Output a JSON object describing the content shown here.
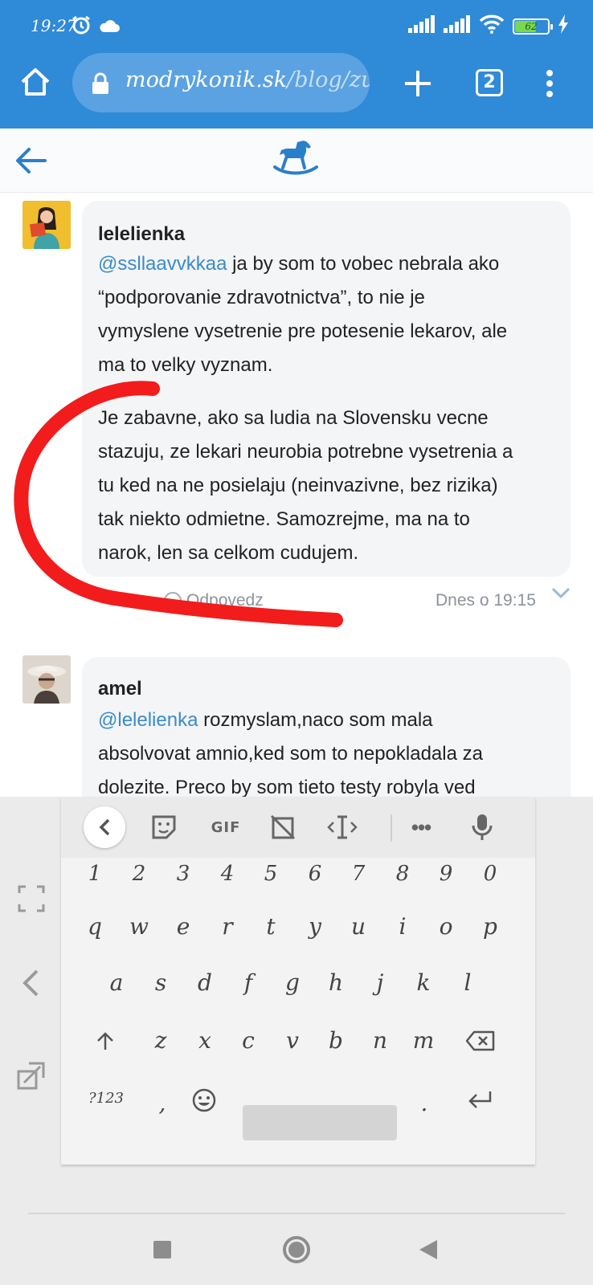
{
  "status_bar": {
    "time": "19:27",
    "battery": "62"
  },
  "browser": {
    "url_domain": "modrykonik.sk",
    "url_path": "/blog/zu:",
    "tab_count": "2"
  },
  "icons": {
    "status": [
      "alarm-icon",
      "cloud-icon",
      "signal-icon",
      "wifi-icon",
      "battery-icon",
      "charging-icon"
    ],
    "browser": [
      "home-icon",
      "lock-icon",
      "plus-icon",
      "tabs-icon",
      "more-vert-icon"
    ],
    "site": [
      "back-arrow-icon",
      "rocking-horse-logo-icon"
    ],
    "keyboard_toolbar": [
      "chevron-left-icon",
      "sticker-icon",
      "gif-icon",
      "clipboard-off-icon",
      "cursor-icon",
      "more-icon",
      "mic-icon"
    ],
    "keyboard_side": [
      "expand-icon",
      "chevron-left-icon",
      "float-icon"
    ],
    "nav": [
      "square-nav-icon",
      "circle-nav-icon",
      "triangle-nav-icon"
    ]
  },
  "colors": {
    "browser_blue": "#2f8ad8",
    "mention_blue": "#3a8bcb",
    "annotation_red": "#f21c1c"
  },
  "comments": [
    {
      "author": "lelelienka",
      "mention": "@ssllaavvkkaa",
      "text_line1_rest": " ja by som to vobec nebrala ako",
      "text_lines": [
        "“podporovanie zdravotnictva”, to nie je",
        "vymyslene vysetrenie pre potesenie lekarov, ale",
        "ma to velky vyznam."
      ],
      "para2_lines": [
        "Je zabavne, ako sa ludia na Slovensku vecne",
        "stazuju, ze lekari neurobia potrebne vysetrenia a",
        "tu ked na ne posielaju (neinvazivne, bez rizika)",
        "tak niekto odmietne. Samozrejme, ma na to",
        "narok, len sa celkom cudujem."
      ],
      "reply_label": "Odpovedz",
      "timestamp": "Dnes o 19:15"
    },
    {
      "author": "amel",
      "mention": "@lelelienka",
      "text_line1_rest": " rozmyslam,naco som mala",
      "text_lines": [
        "absolvovat amnio,ked som to nepokladala za",
        "dolezite. Preco by som tieto testy robyla ved"
      ]
    }
  ],
  "keyboard": {
    "toolbar_gif": "GIF",
    "toolbar_more": "•••",
    "numbers": [
      "1",
      "2",
      "3",
      "4",
      "5",
      "6",
      "7",
      "8",
      "9",
      "0"
    ],
    "row1": [
      "q",
      "w",
      "e",
      "r",
      "t",
      "y",
      "u",
      "i",
      "o",
      "p"
    ],
    "row2": [
      "a",
      "s",
      "d",
      "f",
      "g",
      "h",
      "j",
      "k",
      "l"
    ],
    "row3": [
      "z",
      "x",
      "c",
      "v",
      "b",
      "n",
      "m"
    ],
    "symbols_key": "?123",
    "comma_key": ",",
    "period_key": "."
  }
}
